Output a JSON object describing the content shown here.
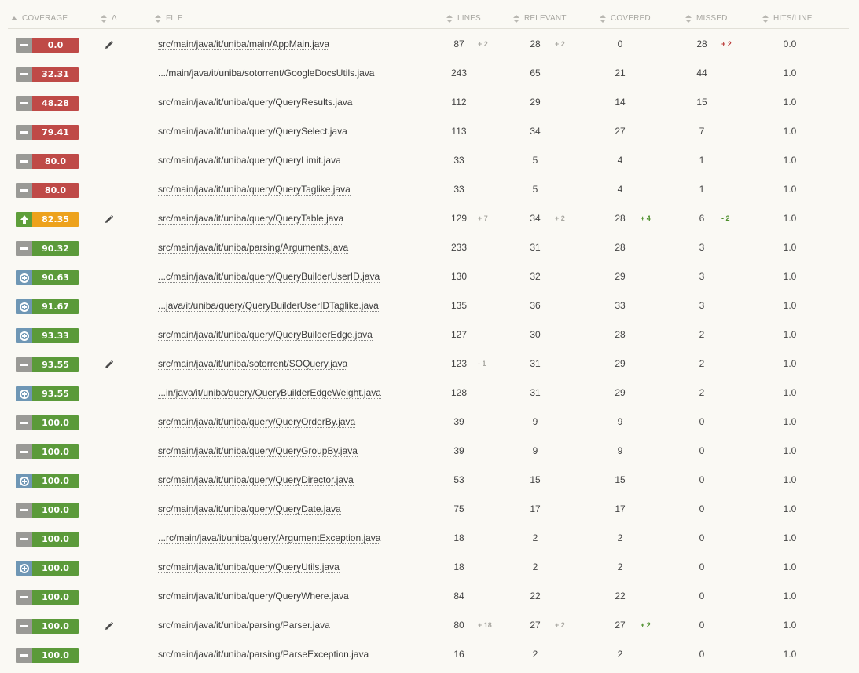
{
  "headers": {
    "coverage": "COVERAGE",
    "delta": "Δ",
    "file": "FILE",
    "lines": "LINES",
    "relevant": "RELEVANT",
    "covered": "COVERED",
    "missed": "MISSED",
    "hits": "HITS/LINE"
  },
  "colors": {
    "red": "#bf4a47",
    "green": "#5b9a3a",
    "orange": "#eda21c"
  },
  "rows": [
    {
      "coverage": "0.0",
      "icon": "minus",
      "color": "red",
      "edited": true,
      "file": "src/main/java/it/uniba/main/AppMain.java",
      "lines": "87",
      "lines_delta": "+ 2",
      "relevant": "28",
      "relevant_delta": "+ 2",
      "covered": "0",
      "covered_delta": "",
      "missed": "28",
      "missed_delta": "+ 2",
      "hits": "0.0"
    },
    {
      "coverage": "32.31",
      "icon": "minus",
      "color": "red",
      "edited": false,
      "file": ".../main/java/it/uniba/sotorrent/GoogleDocsUtils.java",
      "lines": "243",
      "lines_delta": "",
      "relevant": "65",
      "relevant_delta": "",
      "covered": "21",
      "covered_delta": "",
      "missed": "44",
      "missed_delta": "",
      "hits": "1.0"
    },
    {
      "coverage": "48.28",
      "icon": "minus",
      "color": "red",
      "edited": false,
      "file": "src/main/java/it/uniba/query/QueryResults.java",
      "lines": "112",
      "lines_delta": "",
      "relevant": "29",
      "relevant_delta": "",
      "covered": "14",
      "covered_delta": "",
      "missed": "15",
      "missed_delta": "",
      "hits": "1.0"
    },
    {
      "coverage": "79.41",
      "icon": "minus",
      "color": "red",
      "edited": false,
      "file": "src/main/java/it/uniba/query/QuerySelect.java",
      "lines": "113",
      "lines_delta": "",
      "relevant": "34",
      "relevant_delta": "",
      "covered": "27",
      "covered_delta": "",
      "missed": "7",
      "missed_delta": "",
      "hits": "1.0"
    },
    {
      "coverage": "80.0",
      "icon": "minus",
      "color": "red",
      "edited": false,
      "file": "src/main/java/it/uniba/query/QueryLimit.java",
      "lines": "33",
      "lines_delta": "",
      "relevant": "5",
      "relevant_delta": "",
      "covered": "4",
      "covered_delta": "",
      "missed": "1",
      "missed_delta": "",
      "hits": "1.0"
    },
    {
      "coverage": "80.0",
      "icon": "minus",
      "color": "red",
      "edited": false,
      "file": "src/main/java/it/uniba/query/QueryTaglike.java",
      "lines": "33",
      "lines_delta": "",
      "relevant": "5",
      "relevant_delta": "",
      "covered": "4",
      "covered_delta": "",
      "missed": "1",
      "missed_delta": "",
      "hits": "1.0"
    },
    {
      "coverage": "82.35",
      "icon": "up",
      "color": "orange",
      "edited": true,
      "file": "src/main/java/it/uniba/query/QueryTable.java",
      "lines": "129",
      "lines_delta": "+ 7",
      "relevant": "34",
      "relevant_delta": "+ 2",
      "covered": "28",
      "covered_delta": "+ 4",
      "missed": "6",
      "missed_delta": "- 2",
      "hits": "1.0"
    },
    {
      "coverage": "90.32",
      "icon": "minus",
      "color": "green",
      "edited": false,
      "file": "src/main/java/it/uniba/parsing/Arguments.java",
      "lines": "233",
      "lines_delta": "",
      "relevant": "31",
      "relevant_delta": "",
      "covered": "28",
      "covered_delta": "",
      "missed": "3",
      "missed_delta": "",
      "hits": "1.0"
    },
    {
      "coverage": "90.63",
      "icon": "plus",
      "color": "green",
      "edited": false,
      "file": "...c/main/java/it/uniba/query/QueryBuilderUserID.java",
      "lines": "130",
      "lines_delta": "",
      "relevant": "32",
      "relevant_delta": "",
      "covered": "29",
      "covered_delta": "",
      "missed": "3",
      "missed_delta": "",
      "hits": "1.0"
    },
    {
      "coverage": "91.67",
      "icon": "plus",
      "color": "green",
      "edited": false,
      "file": "...java/it/uniba/query/QueryBuilderUserIDTaglike.java",
      "lines": "135",
      "lines_delta": "",
      "relevant": "36",
      "relevant_delta": "",
      "covered": "33",
      "covered_delta": "",
      "missed": "3",
      "missed_delta": "",
      "hits": "1.0"
    },
    {
      "coverage": "93.33",
      "icon": "plus",
      "color": "green",
      "edited": false,
      "file": "src/main/java/it/uniba/query/QueryBuilderEdge.java",
      "lines": "127",
      "lines_delta": "",
      "relevant": "30",
      "relevant_delta": "",
      "covered": "28",
      "covered_delta": "",
      "missed": "2",
      "missed_delta": "",
      "hits": "1.0"
    },
    {
      "coverage": "93.55",
      "icon": "minus",
      "color": "green",
      "edited": true,
      "file": "src/main/java/it/uniba/sotorrent/SOQuery.java",
      "lines": "123",
      "lines_delta": "- 1",
      "relevant": "31",
      "relevant_delta": "",
      "covered": "29",
      "covered_delta": "",
      "missed": "2",
      "missed_delta": "",
      "hits": "1.0"
    },
    {
      "coverage": "93.55",
      "icon": "plus",
      "color": "green",
      "edited": false,
      "file": "...in/java/it/uniba/query/QueryBuilderEdgeWeight.java",
      "lines": "128",
      "lines_delta": "",
      "relevant": "31",
      "relevant_delta": "",
      "covered": "29",
      "covered_delta": "",
      "missed": "2",
      "missed_delta": "",
      "hits": "1.0"
    },
    {
      "coverage": "100.0",
      "icon": "minus",
      "color": "green",
      "edited": false,
      "file": "src/main/java/it/uniba/query/QueryOrderBy.java",
      "lines": "39",
      "lines_delta": "",
      "relevant": "9",
      "relevant_delta": "",
      "covered": "9",
      "covered_delta": "",
      "missed": "0",
      "missed_delta": "",
      "hits": "1.0"
    },
    {
      "coverage": "100.0",
      "icon": "minus",
      "color": "green",
      "edited": false,
      "file": "src/main/java/it/uniba/query/QueryGroupBy.java",
      "lines": "39",
      "lines_delta": "",
      "relevant": "9",
      "relevant_delta": "",
      "covered": "9",
      "covered_delta": "",
      "missed": "0",
      "missed_delta": "",
      "hits": "1.0"
    },
    {
      "coverage": "100.0",
      "icon": "plus",
      "color": "green",
      "edited": false,
      "file": "src/main/java/it/uniba/query/QueryDirector.java",
      "lines": "53",
      "lines_delta": "",
      "relevant": "15",
      "relevant_delta": "",
      "covered": "15",
      "covered_delta": "",
      "missed": "0",
      "missed_delta": "",
      "hits": "1.0"
    },
    {
      "coverage": "100.0",
      "icon": "minus",
      "color": "green",
      "edited": false,
      "file": "src/main/java/it/uniba/query/QueryDate.java",
      "lines": "75",
      "lines_delta": "",
      "relevant": "17",
      "relevant_delta": "",
      "covered": "17",
      "covered_delta": "",
      "missed": "0",
      "missed_delta": "",
      "hits": "1.0"
    },
    {
      "coverage": "100.0",
      "icon": "minus",
      "color": "green",
      "edited": false,
      "file": "...rc/main/java/it/uniba/query/ArgumentException.java",
      "lines": "18",
      "lines_delta": "",
      "relevant": "2",
      "relevant_delta": "",
      "covered": "2",
      "covered_delta": "",
      "missed": "0",
      "missed_delta": "",
      "hits": "1.0"
    },
    {
      "coverage": "100.0",
      "icon": "plus",
      "color": "green",
      "edited": false,
      "file": "src/main/java/it/uniba/query/QueryUtils.java",
      "lines": "18",
      "lines_delta": "",
      "relevant": "2",
      "relevant_delta": "",
      "covered": "2",
      "covered_delta": "",
      "missed": "0",
      "missed_delta": "",
      "hits": "1.0"
    },
    {
      "coverage": "100.0",
      "icon": "minus",
      "color": "green",
      "edited": false,
      "file": "src/main/java/it/uniba/query/QueryWhere.java",
      "lines": "84",
      "lines_delta": "",
      "relevant": "22",
      "relevant_delta": "",
      "covered": "22",
      "covered_delta": "",
      "missed": "0",
      "missed_delta": "",
      "hits": "1.0"
    },
    {
      "coverage": "100.0",
      "icon": "minus",
      "color": "green",
      "edited": true,
      "file": "src/main/java/it/uniba/parsing/Parser.java",
      "lines": "80",
      "lines_delta": "+ 18",
      "relevant": "27",
      "relevant_delta": "+ 2",
      "covered": "27",
      "covered_delta": "+ 2",
      "missed": "0",
      "missed_delta": "",
      "hits": "1.0"
    },
    {
      "coverage": "100.0",
      "icon": "minus",
      "color": "green",
      "edited": false,
      "file": "src/main/java/it/uniba/parsing/ParseException.java",
      "lines": "16",
      "lines_delta": "",
      "relevant": "2",
      "relevant_delta": "",
      "covered": "2",
      "covered_delta": "",
      "missed": "0",
      "missed_delta": "",
      "hits": "1.0"
    }
  ]
}
